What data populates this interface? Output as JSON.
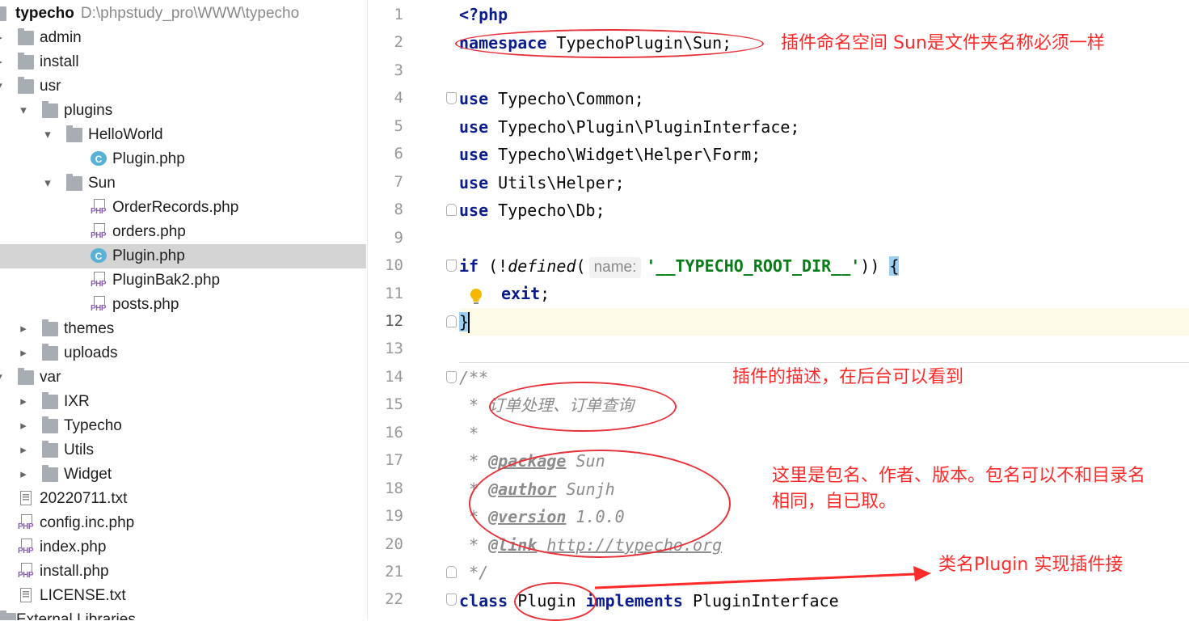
{
  "project_tree": {
    "root_name": "typecho",
    "root_path": "D:\\phpstudy_pro\\WWW\\typecho",
    "items": [
      {
        "label": "admin",
        "type": "folder",
        "level": 1,
        "arrow": "▸"
      },
      {
        "label": "install",
        "type": "folder",
        "level": 1,
        "arrow": "▸"
      },
      {
        "label": "usr",
        "type": "folder",
        "level": 1,
        "arrow": "▾"
      },
      {
        "label": "plugins",
        "type": "folder",
        "level": 2,
        "arrow": "▾"
      },
      {
        "label": "HelloWorld",
        "type": "folder",
        "level": 3,
        "arrow": "▾"
      },
      {
        "label": "Plugin.php",
        "type": "class",
        "level": 4,
        "arrow": ""
      },
      {
        "label": "Sun",
        "type": "folder",
        "level": 3,
        "arrow": "▾"
      },
      {
        "label": "OrderRecords.php",
        "type": "php",
        "level": 4,
        "arrow": ""
      },
      {
        "label": "orders.php",
        "type": "php",
        "level": 4,
        "arrow": ""
      },
      {
        "label": "Plugin.php",
        "type": "class",
        "level": 4,
        "arrow": "",
        "selected": true
      },
      {
        "label": "PluginBak2.php",
        "type": "php",
        "level": 4,
        "arrow": ""
      },
      {
        "label": "posts.php",
        "type": "php",
        "level": 4,
        "arrow": ""
      },
      {
        "label": "themes",
        "type": "folder",
        "level": 2,
        "arrow": "▸"
      },
      {
        "label": "uploads",
        "type": "folder",
        "level": 2,
        "arrow": "▸"
      },
      {
        "label": "var",
        "type": "folder",
        "level": 1,
        "arrow": "▾"
      },
      {
        "label": "IXR",
        "type": "folder",
        "level": 2,
        "arrow": "▸"
      },
      {
        "label": "Typecho",
        "type": "folder",
        "level": 2,
        "arrow": "▸"
      },
      {
        "label": "Utils",
        "type": "folder",
        "level": 2,
        "arrow": "▸"
      },
      {
        "label": "Widget",
        "type": "folder",
        "level": 2,
        "arrow": "▸"
      },
      {
        "label": "20220711.txt",
        "type": "txt",
        "level": 1,
        "arrow": ""
      },
      {
        "label": "config.inc.php",
        "type": "php",
        "level": 1,
        "arrow": ""
      },
      {
        "label": "index.php",
        "type": "php",
        "level": 1,
        "arrow": ""
      },
      {
        "label": "install.php",
        "type": "php",
        "level": 1,
        "arrow": ""
      },
      {
        "label": "LICENSE.txt",
        "type": "txt",
        "level": 1,
        "arrow": ""
      },
      {
        "label": "External Libraries",
        "type": "lib",
        "level": 0,
        "arrow": "▸"
      }
    ]
  },
  "editor": {
    "line_numbers": [
      "1",
      "2",
      "3",
      "4",
      "5",
      "6",
      "7",
      "8",
      "9",
      "10",
      "11",
      "12",
      "13",
      "14",
      "15",
      "16",
      "17",
      "18",
      "19",
      "20",
      "21",
      "22"
    ],
    "current_line": "12",
    "inlay_hint": "name:",
    "code": {
      "l1": "<?php",
      "l2_kw": "namespace",
      "l2_rest": " TypechoPlugin\\Sun;",
      "l4_kw": "use",
      "l4_rest": " Typecho\\Common;",
      "l5_kw": "use",
      "l5_rest": " Typecho\\Plugin\\PluginInterface;",
      "l6_kw": "use",
      "l6_rest": " Typecho\\Widget\\Helper\\Form;",
      "l7_kw": "use",
      "l7_rest": " Utils\\Helper;",
      "l8_kw": "use",
      "l8_rest": " Typecho\\Db;",
      "l10_kw": "if",
      "l10_a": " (!",
      "l10_fn": "defined",
      "l10_b": "(",
      "l10_str": "'__TYPECHO_ROOT_DIR__'",
      "l10_c": ")) ",
      "l10_brace": "{",
      "l11_kw": "exit",
      "l11_rest": ";",
      "l12": "}",
      "l14": "/**",
      "l15": " * 订单处理、订单查询",
      "l16": " *",
      "l17_pre": " * ",
      "l17_tag": "@package",
      "l17_val": " Sun",
      "l18_pre": " * ",
      "l18_tag": "@author",
      "l18_val": " Sunjh",
      "l19_pre": " * ",
      "l19_tag": "@version",
      "l19_val": " 1.0.0",
      "l20_pre": " * ",
      "l20_tag": "@link",
      "l20_sp": " ",
      "l20_val": "http://typecho.org",
      "l21": " */",
      "l22_kw": "class",
      "l22_name": " Plugin ",
      "l22_kw2": "implements",
      "l22_rest": " PluginInterface"
    }
  },
  "annotations": {
    "namespace_note": "插件命名空间 Sun是文件夹名称必须一样",
    "description_note": "插件的描述，在后台可以看到",
    "meta_note_line1": "这里是包名、作者、版本。包名可以不和目录名",
    "meta_note_line2": "相同，自已取。",
    "class_note": "类名Plugin 实现插件接"
  },
  "colors": {
    "keyword": "#0b1d8c",
    "string": "#067d17",
    "comment": "#8c8c8c",
    "annotation": "#ff2a2a",
    "selection": "#d4d4d4",
    "current_line": "#fdfbe7"
  },
  "icons": {
    "folder": "folder-icon",
    "php_file": "php-file-icon",
    "class_file": "php-class-icon",
    "text_file": "text-file-icon",
    "intention": "lightbulb-icon"
  }
}
